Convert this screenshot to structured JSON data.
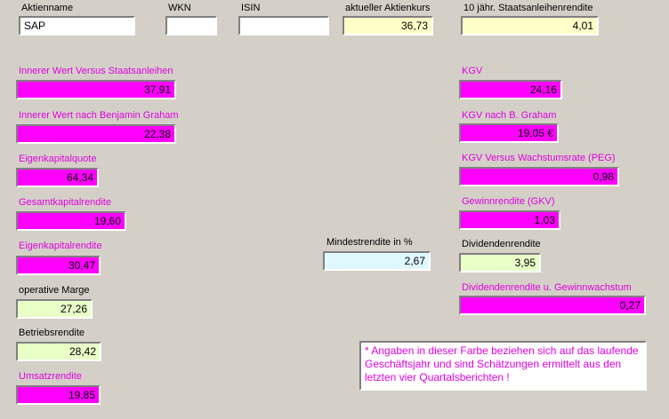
{
  "header": {
    "aktienname": {
      "label": "Aktienname",
      "value": "SAP"
    },
    "wkn": {
      "label": "WKN",
      "value": ""
    },
    "isin": {
      "label": "ISIN",
      "value": ""
    },
    "kurs": {
      "label": "aktueller Aktienkurs",
      "value": "36,73"
    },
    "staatsanleihe": {
      "label": "10 jähr. Staatsanleihenrendite",
      "value": "4,01"
    }
  },
  "left": {
    "innerer_wert_staat": {
      "label": "Innerer Wert Versus Staatsanleihen",
      "value": "37,91"
    },
    "innerer_wert_graham": {
      "label": "Innerer Wert nach Benjamin Graham",
      "value": "22,38"
    },
    "eigenkapitalquote": {
      "label": "Eigenkapitalquote",
      "value": "64,34"
    },
    "gesamtkapitalrendite": {
      "label": "Gesamtkapitalrendite",
      "value": "19,60"
    },
    "eigenkapitalrendite": {
      "label": "Eigenkapitalrendite",
      "value": "30,47"
    },
    "operative_marge": {
      "label": "operative Marge",
      "value": "27,26"
    },
    "betriebsrendite": {
      "label": "Betriebsrendite",
      "value": "28,42"
    },
    "umsatzrendite": {
      "label": "Umsatzrendite",
      "value": "19,85"
    }
  },
  "middle": {
    "mindestrendite": {
      "label": "Mindestrendite in %",
      "value": "2,67"
    }
  },
  "right": {
    "kgv": {
      "label": "KGV",
      "value": "24,16"
    },
    "kgv_graham": {
      "label": "KGV nach B. Graham",
      "value": "19,05 €"
    },
    "peg": {
      "label": "KGV Versus Wachstumsrate (PEG)",
      "value": "0,98"
    },
    "gewinnrendite": {
      "label": "Gewinnrendite (GKV)",
      "value": "1,03"
    },
    "dividendenrendite": {
      "label": "Dividendenrendite",
      "value": "3,95"
    },
    "div_wachstum": {
      "label": "Dividendenrendite u. Gewinnwachstum",
      "value": "0,27"
    }
  },
  "note": "* Angaben in dieser Farbe beziehen sich auf das laufende Geschäftsjahr und sind Schätzungen ermittelt aus den letzten vier Quartalsberichten !",
  "colors": {
    "background": "#d4d0c8",
    "estimate_field": "#ff00ff",
    "estimate_label": "#e000e0",
    "input_yellow": "#ffffc8",
    "result_green": "#e8ffc8",
    "result_blue": "#e0f8ff"
  }
}
